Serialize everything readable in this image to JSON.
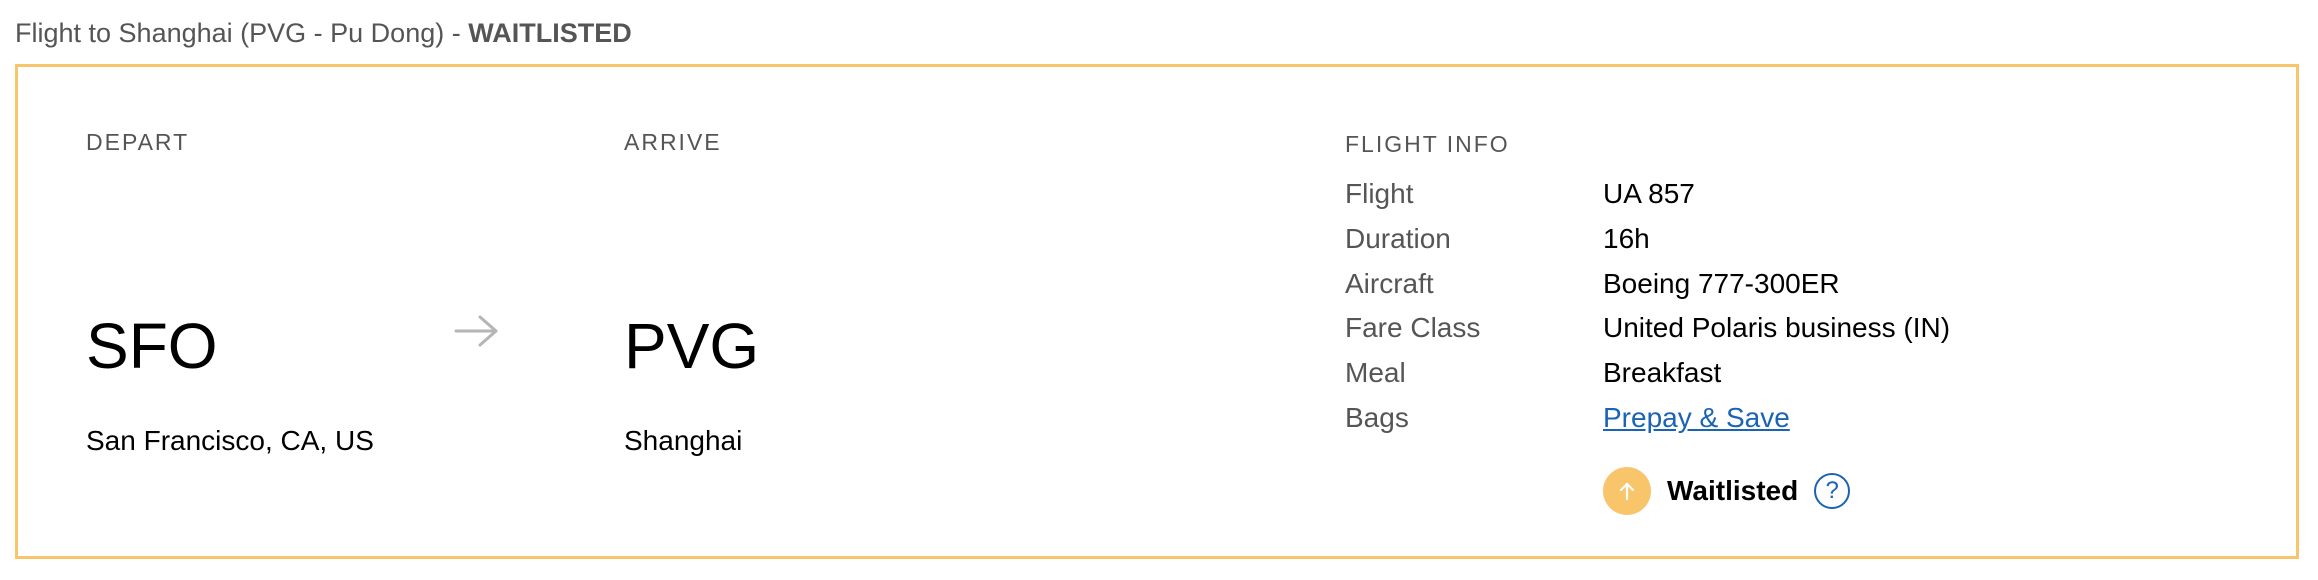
{
  "heading": {
    "prefix": "Flight to Shanghai (PVG - Pu Dong) - ",
    "status": "WAITLISTED"
  },
  "depart": {
    "label": "DEPART",
    "code": "SFO",
    "city": "San Francisco, CA, US"
  },
  "arrive": {
    "label": "ARRIVE",
    "code": "PVG",
    "city": "Shanghai"
  },
  "flight_info": {
    "label": "FLIGHT INFO",
    "rows": [
      {
        "key": "Flight",
        "value": "UA 857"
      },
      {
        "key": "Duration",
        "value": "16h"
      },
      {
        "key": "Aircraft",
        "value": "Boeing 777-300ER"
      },
      {
        "key": "Fare Class",
        "value": "United Polaris business (IN)"
      },
      {
        "key": "Meal",
        "value": "Breakfast"
      },
      {
        "key": "Bags",
        "value": "Prepay & Save"
      }
    ]
  },
  "waitlist": {
    "label": "Waitlisted",
    "help_glyph": "?"
  },
  "icons": {
    "route_arrow": "arrow-right-icon",
    "waitlist": "arrow-up-circle-icon",
    "help": "help-icon"
  },
  "colors": {
    "border": "#f9c56a",
    "waitlist_badge": "#f9c56a",
    "link": "#1a63b5",
    "muted_text": "#555555"
  }
}
